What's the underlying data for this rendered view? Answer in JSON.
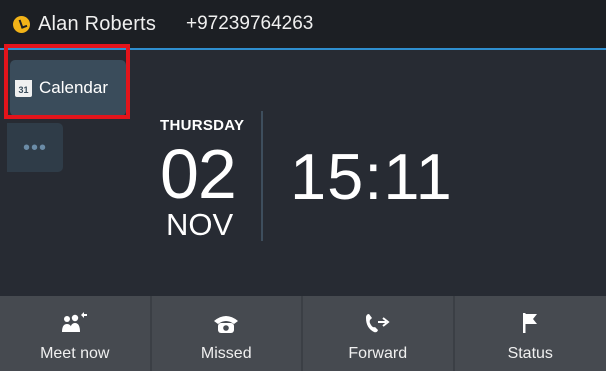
{
  "status_bar": {
    "user_name": "Alan Roberts",
    "phone_number": "+97239764263",
    "presence_color": "#f2b318"
  },
  "side_tabs": {
    "calendar": {
      "label": "Calendar",
      "icon": "calendar-icon",
      "icon_text": "31",
      "highlighted": true
    },
    "more": {
      "icon": "more-dots-icon",
      "glyph": "•••"
    }
  },
  "datetime": {
    "weekday": "THURSDAY",
    "day": "02",
    "month": "NOV",
    "time": "15:11"
  },
  "softkeys": [
    {
      "label": "Meet now",
      "icon": "meet-now-icon"
    },
    {
      "label": "Missed",
      "icon": "missed-call-icon"
    },
    {
      "label": "Forward",
      "icon": "call-forward-icon"
    },
    {
      "label": "Status",
      "icon": "status-flag-icon"
    }
  ],
  "colors": {
    "background": "#272b33",
    "status_bar": "#1c1f24",
    "accent_line": "#2f8fcf",
    "highlight": "#e3141b",
    "softkey_bg": "#464a50"
  }
}
